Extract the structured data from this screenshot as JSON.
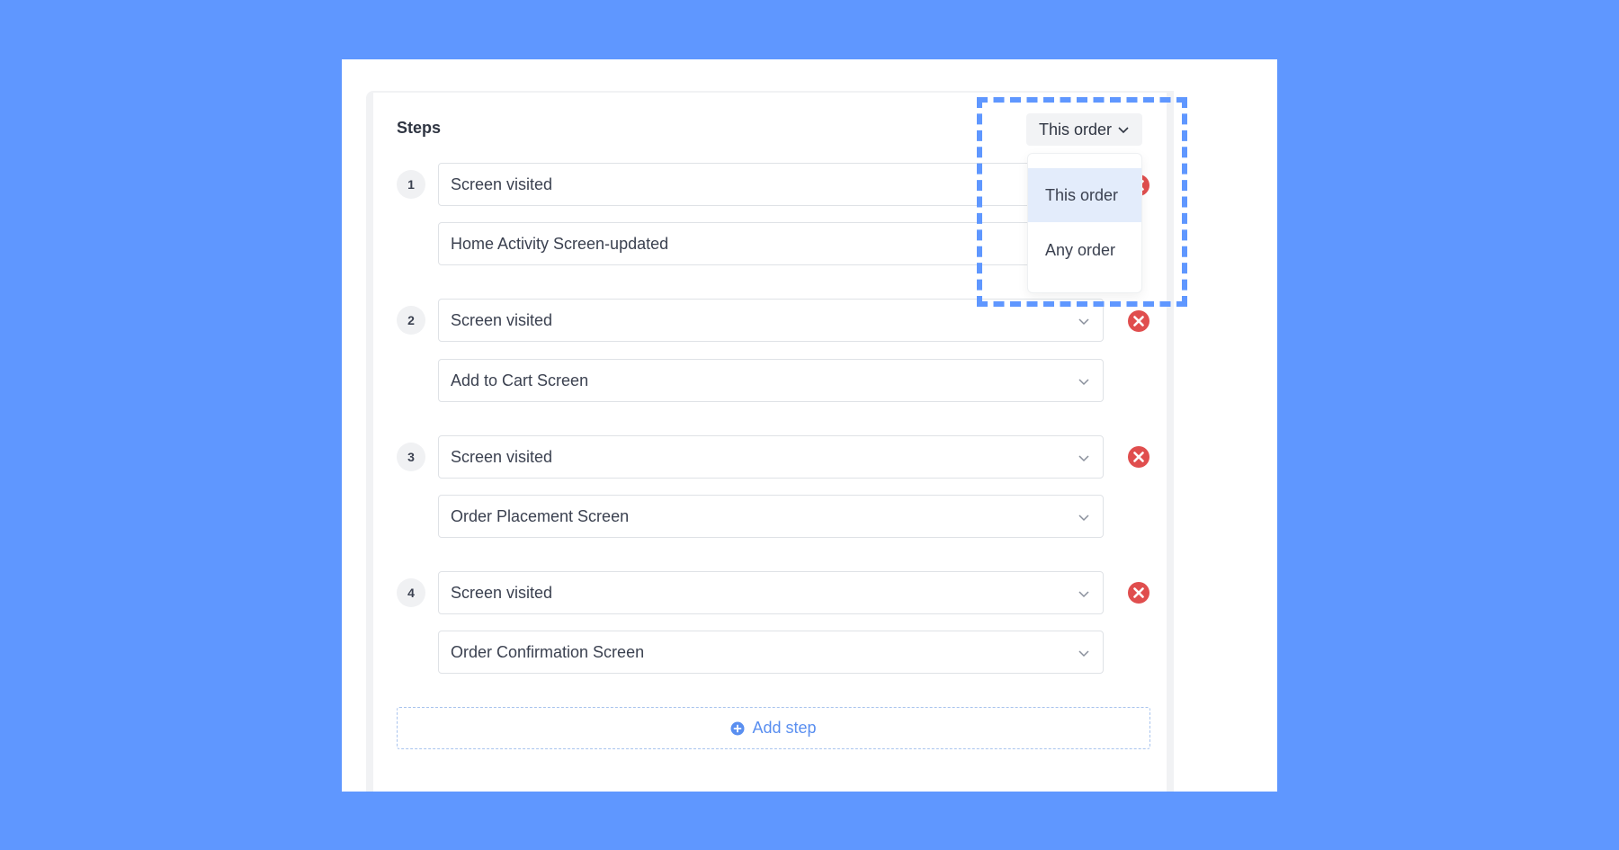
{
  "steps_title": "Steps",
  "order_dropdown": {
    "selected": "This order",
    "options": [
      "This order",
      "Any order"
    ],
    "active_index": 0
  },
  "steps": [
    {
      "number": "1",
      "event": "Screen visited",
      "screen": "Home Activity Screen-updated"
    },
    {
      "number": "2",
      "event": "Screen visited",
      "screen": "Add to Cart Screen"
    },
    {
      "number": "3",
      "event": "Screen visited",
      "screen": "Order Placement Screen"
    },
    {
      "number": "4",
      "event": "Screen visited",
      "screen": "Order Confirmation Screen"
    }
  ],
  "add_step_label": "Add step",
  "colors": {
    "background": "#5f97ff",
    "remove": "#e04e4e",
    "accent": "#5a8ff0",
    "highlight": "#5f97ff"
  },
  "icons": {
    "remove": "close-circle-icon",
    "add": "plus-circle-icon",
    "dropdown": "chevron-down-icon"
  }
}
